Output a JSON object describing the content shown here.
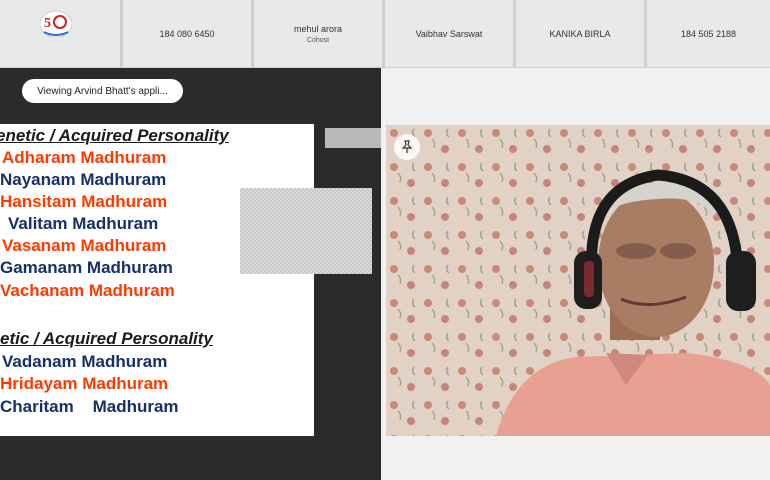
{
  "participants": [
    {
      "name": "184 080 6450",
      "role": ""
    },
    {
      "name": "mehul arora",
      "role": "Cohost"
    },
    {
      "name": "Vaibhav Sarswat",
      "role": ""
    },
    {
      "name": "KANIKA BIRLA",
      "role": ""
    },
    {
      "name": "184 505 2188",
      "role": ""
    }
  ],
  "viewing_label": "Viewing Arvind Bhatt's appli...",
  "slide": {
    "header1": "enetic / Acquired Personality",
    "group1": [
      {
        "text": "Adharam Madhuram",
        "color": "red"
      },
      {
        "text": "Nayanam Madhuram",
        "color": "navy"
      },
      {
        "text": "Hansitam Madhuram",
        "color": "red"
      },
      {
        "text": "Valitam Madhuram",
        "color": "navy"
      },
      {
        "text": "Vasanam Madhuram",
        "color": "red"
      },
      {
        "text": "Gamanam Madhuram",
        "color": "navy"
      },
      {
        "text": "Vachanam Madhuram",
        "color": "red"
      }
    ],
    "header2": "etic / Acquired  Personality",
    "group2": [
      {
        "text": "Vadanam Madhuram",
        "color": "navy"
      },
      {
        "text": "Hridayam Madhuram",
        "color": "red"
      },
      {
        "text": "Charitam    Madhuram",
        "color": "navy"
      }
    ]
  },
  "icons": {
    "logo": "conference-logo-icon",
    "pin": "pin-icon"
  },
  "colors": {
    "navy": "#16306b",
    "red": "#ff3a00"
  }
}
